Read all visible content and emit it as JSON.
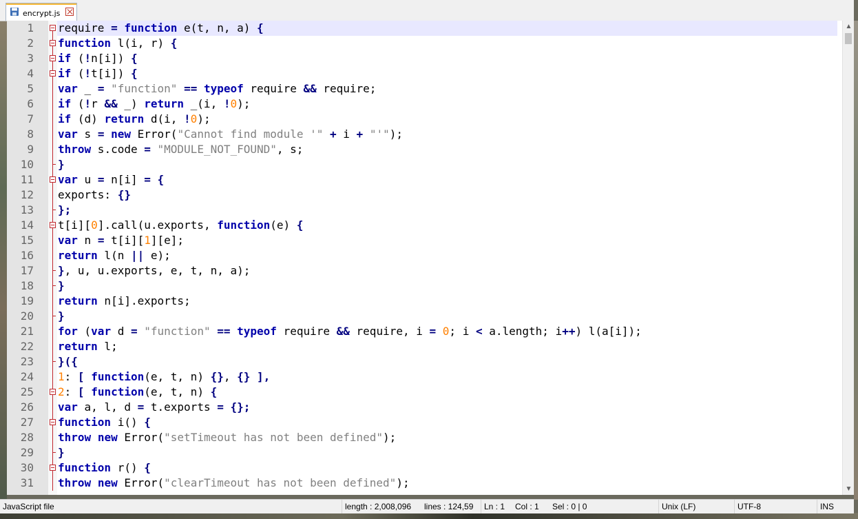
{
  "tab": {
    "label": "encrypt.js",
    "icon": "save-disk-icon"
  },
  "editor": {
    "current_line": 1,
    "lines": [
      {
        "n": "1",
        "fold": "start",
        "tokens": [
          [
            "require",
            ""
          ],
          [
            " = ",
            "o"
          ],
          [
            "function",
            "k"
          ],
          [
            " e(t, n, a) ",
            ""
          ],
          [
            "{",
            "o"
          ]
        ]
      },
      {
        "n": "2",
        "fold": "start",
        "tokens": [
          [
            "function",
            "k"
          ],
          [
            " l(i, r) ",
            ""
          ],
          [
            "{",
            "o"
          ]
        ]
      },
      {
        "n": "3",
        "fold": "start",
        "tokens": [
          [
            "if",
            "k"
          ],
          [
            " (",
            ""
          ],
          [
            "!",
            "o"
          ],
          [
            "n[i]) ",
            ""
          ],
          [
            "{",
            "o"
          ]
        ]
      },
      {
        "n": "4",
        "fold": "start",
        "tokens": [
          [
            "if",
            "k"
          ],
          [
            " (",
            ""
          ],
          [
            "!",
            "o"
          ],
          [
            "t[i]) ",
            ""
          ],
          [
            "{",
            "o"
          ]
        ]
      },
      {
        "n": "5",
        "fold": "line",
        "tokens": [
          [
            "var",
            "k"
          ],
          [
            " _ ",
            ""
          ],
          [
            "=",
            "o"
          ],
          [
            " ",
            ""
          ],
          [
            "\"function\"",
            "s"
          ],
          [
            " ",
            ""
          ],
          [
            "==",
            "o"
          ],
          [
            " ",
            ""
          ],
          [
            "typeof",
            "k"
          ],
          [
            " require ",
            ""
          ],
          [
            "&&",
            "o"
          ],
          [
            " require;",
            ""
          ]
        ]
      },
      {
        "n": "6",
        "fold": "line",
        "tokens": [
          [
            "if",
            "k"
          ],
          [
            " (",
            ""
          ],
          [
            "!",
            "o"
          ],
          [
            "r ",
            ""
          ],
          [
            "&&",
            "o"
          ],
          [
            " _) ",
            ""
          ],
          [
            "return",
            "k"
          ],
          [
            " _(i, ",
            ""
          ],
          [
            "!",
            "o"
          ],
          [
            "0",
            "n"
          ],
          [
            ");",
            ""
          ]
        ]
      },
      {
        "n": "7",
        "fold": "line",
        "tokens": [
          [
            "if",
            "k"
          ],
          [
            " (d) ",
            ""
          ],
          [
            "return",
            "k"
          ],
          [
            " d(i, ",
            ""
          ],
          [
            "!",
            "o"
          ],
          [
            "0",
            "n"
          ],
          [
            ");",
            ""
          ]
        ]
      },
      {
        "n": "8",
        "fold": "line",
        "tokens": [
          [
            "var",
            "k"
          ],
          [
            " s ",
            ""
          ],
          [
            "=",
            "o"
          ],
          [
            " ",
            ""
          ],
          [
            "new",
            "k"
          ],
          [
            " Error(",
            ""
          ],
          [
            "\"Cannot find module '\"",
            "s"
          ],
          [
            " ",
            ""
          ],
          [
            "+",
            "o"
          ],
          [
            " i ",
            ""
          ],
          [
            "+",
            "o"
          ],
          [
            " ",
            ""
          ],
          [
            "\"'\"",
            "s"
          ],
          [
            ");",
            ""
          ]
        ]
      },
      {
        "n": "9",
        "fold": "line",
        "tokens": [
          [
            "throw",
            "k"
          ],
          [
            " s.code ",
            ""
          ],
          [
            "=",
            "o"
          ],
          [
            " ",
            ""
          ],
          [
            "\"MODULE_NOT_FOUND\"",
            "s"
          ],
          [
            ", s;",
            ""
          ]
        ]
      },
      {
        "n": "10",
        "fold": "end",
        "tokens": [
          [
            "}",
            "o"
          ]
        ]
      },
      {
        "n": "11",
        "fold": "start",
        "tokens": [
          [
            "var",
            "k"
          ],
          [
            " u ",
            ""
          ],
          [
            "=",
            "o"
          ],
          [
            " n[i] ",
            ""
          ],
          [
            "=",
            "o"
          ],
          [
            " ",
            ""
          ],
          [
            "{",
            "o"
          ]
        ]
      },
      {
        "n": "12",
        "fold": "line",
        "tokens": [
          [
            "exports: ",
            ""
          ],
          [
            "{}",
            "o"
          ]
        ]
      },
      {
        "n": "13",
        "fold": "end",
        "tokens": [
          [
            "};",
            "o"
          ]
        ]
      },
      {
        "n": "14",
        "fold": "start",
        "tokens": [
          [
            "t[i][",
            ""
          ],
          [
            "0",
            "n"
          ],
          [
            "].call(u.exports, ",
            ""
          ],
          [
            "function",
            "k"
          ],
          [
            "(e) ",
            ""
          ],
          [
            "{",
            "o"
          ]
        ]
      },
      {
        "n": "15",
        "fold": "line",
        "tokens": [
          [
            "var",
            "k"
          ],
          [
            " n ",
            ""
          ],
          [
            "=",
            "o"
          ],
          [
            " t[i][",
            ""
          ],
          [
            "1",
            "n"
          ],
          [
            "][e];",
            ""
          ]
        ]
      },
      {
        "n": "16",
        "fold": "line",
        "tokens": [
          [
            "return",
            "k"
          ],
          [
            " l(n ",
            ""
          ],
          [
            "||",
            "o"
          ],
          [
            " e);",
            ""
          ]
        ]
      },
      {
        "n": "17",
        "fold": "end",
        "tokens": [
          [
            "}",
            "o"
          ],
          [
            ", u, u.exports, e, t, n, a);",
            ""
          ]
        ]
      },
      {
        "n": "18",
        "fold": "end",
        "tokens": [
          [
            "}",
            "o"
          ]
        ]
      },
      {
        "n": "19",
        "fold": "line",
        "tokens": [
          [
            "return",
            "k"
          ],
          [
            " n[i].exports;",
            ""
          ]
        ]
      },
      {
        "n": "20",
        "fold": "end",
        "tokens": [
          [
            "}",
            "o"
          ]
        ]
      },
      {
        "n": "21",
        "fold": "line",
        "tokens": [
          [
            "for",
            "k"
          ],
          [
            " (",
            ""
          ],
          [
            "var",
            "k"
          ],
          [
            " d ",
            ""
          ],
          [
            "=",
            "o"
          ],
          [
            " ",
            ""
          ],
          [
            "\"function\"",
            "s"
          ],
          [
            " ",
            ""
          ],
          [
            "==",
            "o"
          ],
          [
            " ",
            ""
          ],
          [
            "typeof",
            "k"
          ],
          [
            " require ",
            ""
          ],
          [
            "&&",
            "o"
          ],
          [
            " require, i ",
            ""
          ],
          [
            "=",
            "o"
          ],
          [
            " ",
            ""
          ],
          [
            "0",
            "n"
          ],
          [
            "; i ",
            ""
          ],
          [
            "<",
            "o"
          ],
          [
            " a.length; i",
            ""
          ],
          [
            "++",
            "o"
          ],
          [
            ") l(a[i]);",
            ""
          ]
        ]
      },
      {
        "n": "22",
        "fold": "line",
        "tokens": [
          [
            "return",
            "k"
          ],
          [
            " l;",
            ""
          ]
        ]
      },
      {
        "n": "23",
        "fold": "end",
        "tokens": [
          [
            "}({",
            "o"
          ]
        ]
      },
      {
        "n": "24",
        "fold": "line",
        "tokens": [
          [
            "1",
            "n"
          ],
          [
            ": ",
            ""
          ],
          [
            "[",
            "o"
          ],
          [
            " ",
            ""
          ],
          [
            "function",
            "k"
          ],
          [
            "(e, t, n) ",
            ""
          ],
          [
            "{}",
            "o"
          ],
          [
            ", ",
            ""
          ],
          [
            "{}",
            "o"
          ],
          [
            " ",
            ""
          ],
          [
            "],",
            "o"
          ]
        ]
      },
      {
        "n": "25",
        "fold": "start",
        "tokens": [
          [
            "2",
            "n"
          ],
          [
            ": ",
            ""
          ],
          [
            "[",
            "o"
          ],
          [
            " ",
            ""
          ],
          [
            "function",
            "k"
          ],
          [
            "(e, t, n) ",
            ""
          ],
          [
            "{",
            "o"
          ]
        ]
      },
      {
        "n": "26",
        "fold": "line",
        "tokens": [
          [
            "var",
            "k"
          ],
          [
            " a, l, d ",
            ""
          ],
          [
            "=",
            "o"
          ],
          [
            " t.exports ",
            ""
          ],
          [
            "=",
            "o"
          ],
          [
            " ",
            ""
          ],
          [
            "{};",
            "o"
          ]
        ]
      },
      {
        "n": "27",
        "fold": "start",
        "tokens": [
          [
            "function",
            "k"
          ],
          [
            " i() ",
            ""
          ],
          [
            "{",
            "o"
          ]
        ]
      },
      {
        "n": "28",
        "fold": "line",
        "tokens": [
          [
            "throw",
            "k"
          ],
          [
            " ",
            ""
          ],
          [
            "new",
            "k"
          ],
          [
            " Error(",
            ""
          ],
          [
            "\"setTimeout has not been defined\"",
            "s"
          ],
          [
            ");",
            ""
          ]
        ]
      },
      {
        "n": "29",
        "fold": "end",
        "tokens": [
          [
            "}",
            "o"
          ]
        ]
      },
      {
        "n": "30",
        "fold": "start",
        "tokens": [
          [
            "function",
            "k"
          ],
          [
            " r() ",
            ""
          ],
          [
            "{",
            "o"
          ]
        ]
      },
      {
        "n": "31",
        "fold": "line",
        "tokens": [
          [
            "throw",
            "k"
          ],
          [
            " ",
            ""
          ],
          [
            "new",
            "k"
          ],
          [
            " Error(",
            ""
          ],
          [
            "\"clearTimeout has not been defined\"",
            "s"
          ],
          [
            ");",
            ""
          ]
        ]
      }
    ]
  },
  "statusbar": {
    "file_type": "JavaScript file",
    "length": "length : 2,008,096",
    "lines": "lines : 124,59",
    "ln": "Ln : 1",
    "col": "Col : 1",
    "sel": "Sel : 0 | 0",
    "eol": "Unix (LF)",
    "encoding": "UTF-8",
    "mode": "INS"
  },
  "colors": {
    "keyword": "#0000aa",
    "string": "#808080",
    "number": "#ff8000",
    "operator": "#000080",
    "fold_marker": "#c0272d",
    "current_line": "#e8e8ff"
  }
}
